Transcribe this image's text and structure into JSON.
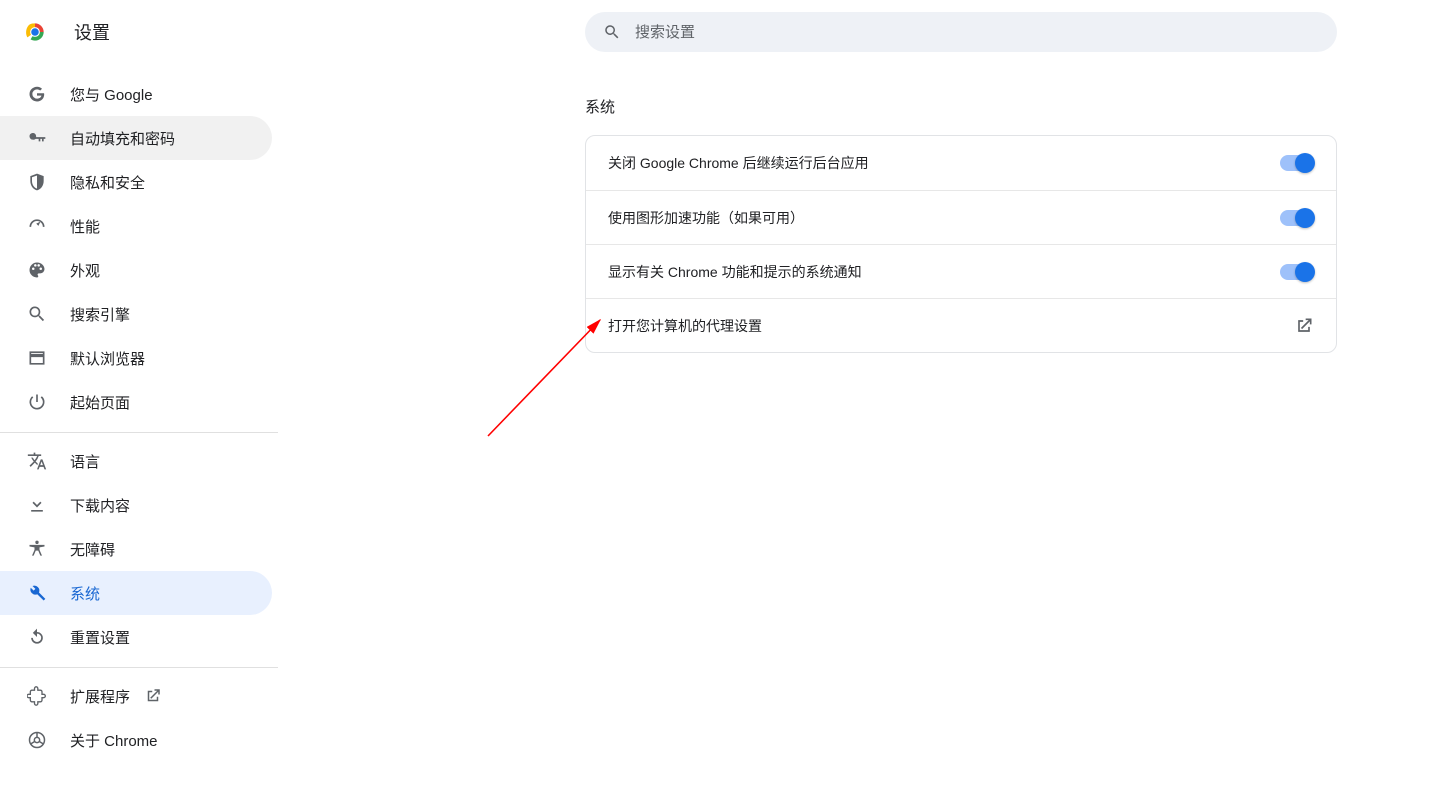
{
  "header": {
    "title": "设置"
  },
  "search": {
    "placeholder": "搜索设置"
  },
  "sidebar": {
    "items": [
      {
        "label": "您与 Google"
      },
      {
        "label": "自动填充和密码"
      },
      {
        "label": "隐私和安全"
      },
      {
        "label": "性能"
      },
      {
        "label": "外观"
      },
      {
        "label": "搜索引擎"
      },
      {
        "label": "默认浏览器"
      },
      {
        "label": "起始页面"
      }
    ],
    "items2": [
      {
        "label": "语言"
      },
      {
        "label": "下载内容"
      },
      {
        "label": "无障碍"
      },
      {
        "label": "系统"
      },
      {
        "label": "重置设置"
      }
    ],
    "items3": [
      {
        "label": "扩展程序"
      },
      {
        "label": "关于 Chrome"
      }
    ]
  },
  "main": {
    "section_title": "系统",
    "rows": [
      {
        "label": "关闭 Google Chrome 后继续运行后台应用",
        "toggle": true
      },
      {
        "label": "使用图形加速功能（如果可用）",
        "toggle": true
      },
      {
        "label": "显示有关 Chrome 功能和提示的系统通知",
        "toggle": true
      },
      {
        "label": "打开您计算机的代理设置"
      }
    ]
  }
}
